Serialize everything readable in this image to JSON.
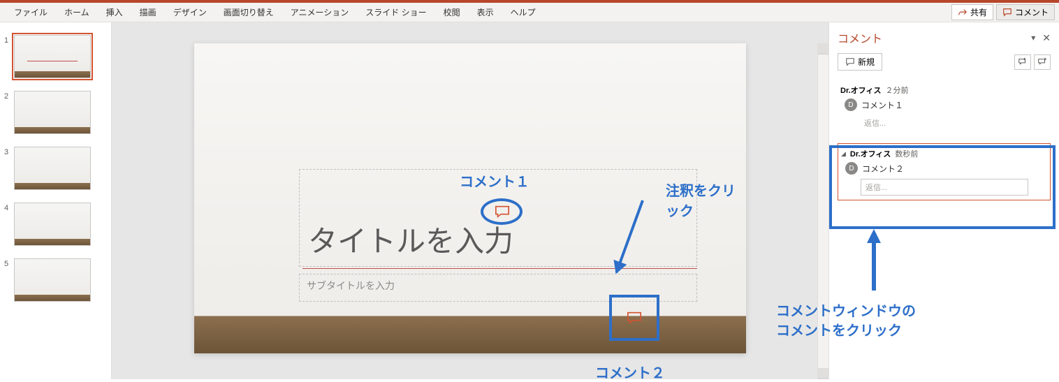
{
  "ribbon": {
    "tabs": [
      "ファイル",
      "ホーム",
      "挿入",
      "描画",
      "デザイン",
      "画面切り替え",
      "アニメーション",
      "スライド ショー",
      "校閲",
      "表示",
      "ヘルプ"
    ],
    "share": "共有",
    "comment": "コメント"
  },
  "thumbnails": {
    "count": 5,
    "selected": 1,
    "numbers": [
      "1",
      "2",
      "3",
      "4",
      "5"
    ]
  },
  "slide": {
    "title_placeholder": "タイトルを入力",
    "subtitle_placeholder": "サブタイトルを入力"
  },
  "annotations": {
    "comment1": "コメント１",
    "comment2": "コメント２",
    "click_annotation": "注釈をクリック",
    "pane_instruction_line1": "コメントウィンドウの",
    "pane_instruction_line2": "コメントをクリック"
  },
  "comments_pane": {
    "title": "コメント",
    "new_label": "新規",
    "threads": [
      {
        "author": "Dr.オフィス",
        "time": "２分前",
        "avatar": "D",
        "text": "コメント１",
        "reply_placeholder": "返信...",
        "selected": false
      },
      {
        "author": "Dr.オフィス",
        "time": "数秒前",
        "avatar": "D",
        "text": "コメント２",
        "reply_placeholder": "返信...",
        "selected": true
      }
    ]
  }
}
